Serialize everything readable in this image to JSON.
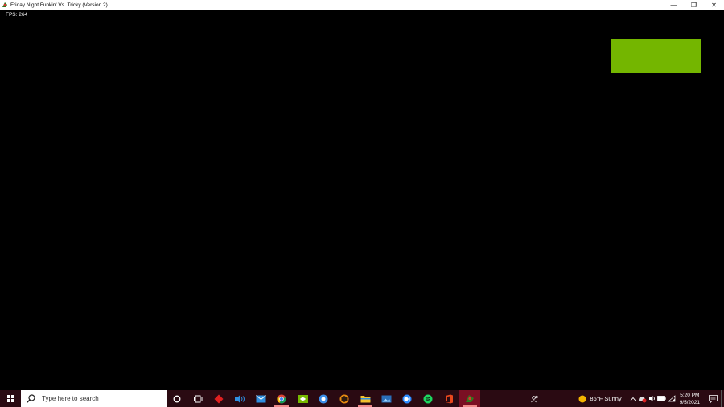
{
  "window": {
    "title": "Friday Night Funkin' Vs. Tricky (Version 2)",
    "minimize": "—",
    "restore": "❐",
    "close": "✕"
  },
  "game": {
    "fps_label": "FPS: 264",
    "block_color": "#74b600"
  },
  "taskbar": {
    "search_placeholder": "Type here to search",
    "apps": [
      {
        "name": "cortana-icon"
      },
      {
        "name": "task-view-icon"
      },
      {
        "name": "red-diamond-app-icon"
      },
      {
        "name": "audio-app-icon"
      },
      {
        "name": "mail-icon"
      },
      {
        "name": "chrome-icon"
      },
      {
        "name": "nvidia-icon"
      },
      {
        "name": "blue-circle-app-icon"
      },
      {
        "name": "orange-app-icon"
      },
      {
        "name": "file-explorer-icon"
      },
      {
        "name": "photos-icon"
      },
      {
        "name": "zoom-icon"
      },
      {
        "name": "spotify-icon"
      },
      {
        "name": "office-icon"
      },
      {
        "name": "fnf-game-icon"
      }
    ]
  },
  "tray": {
    "weather": "86°F  Sunny",
    "time": "5:20 PM",
    "date": "9/5/2021"
  }
}
